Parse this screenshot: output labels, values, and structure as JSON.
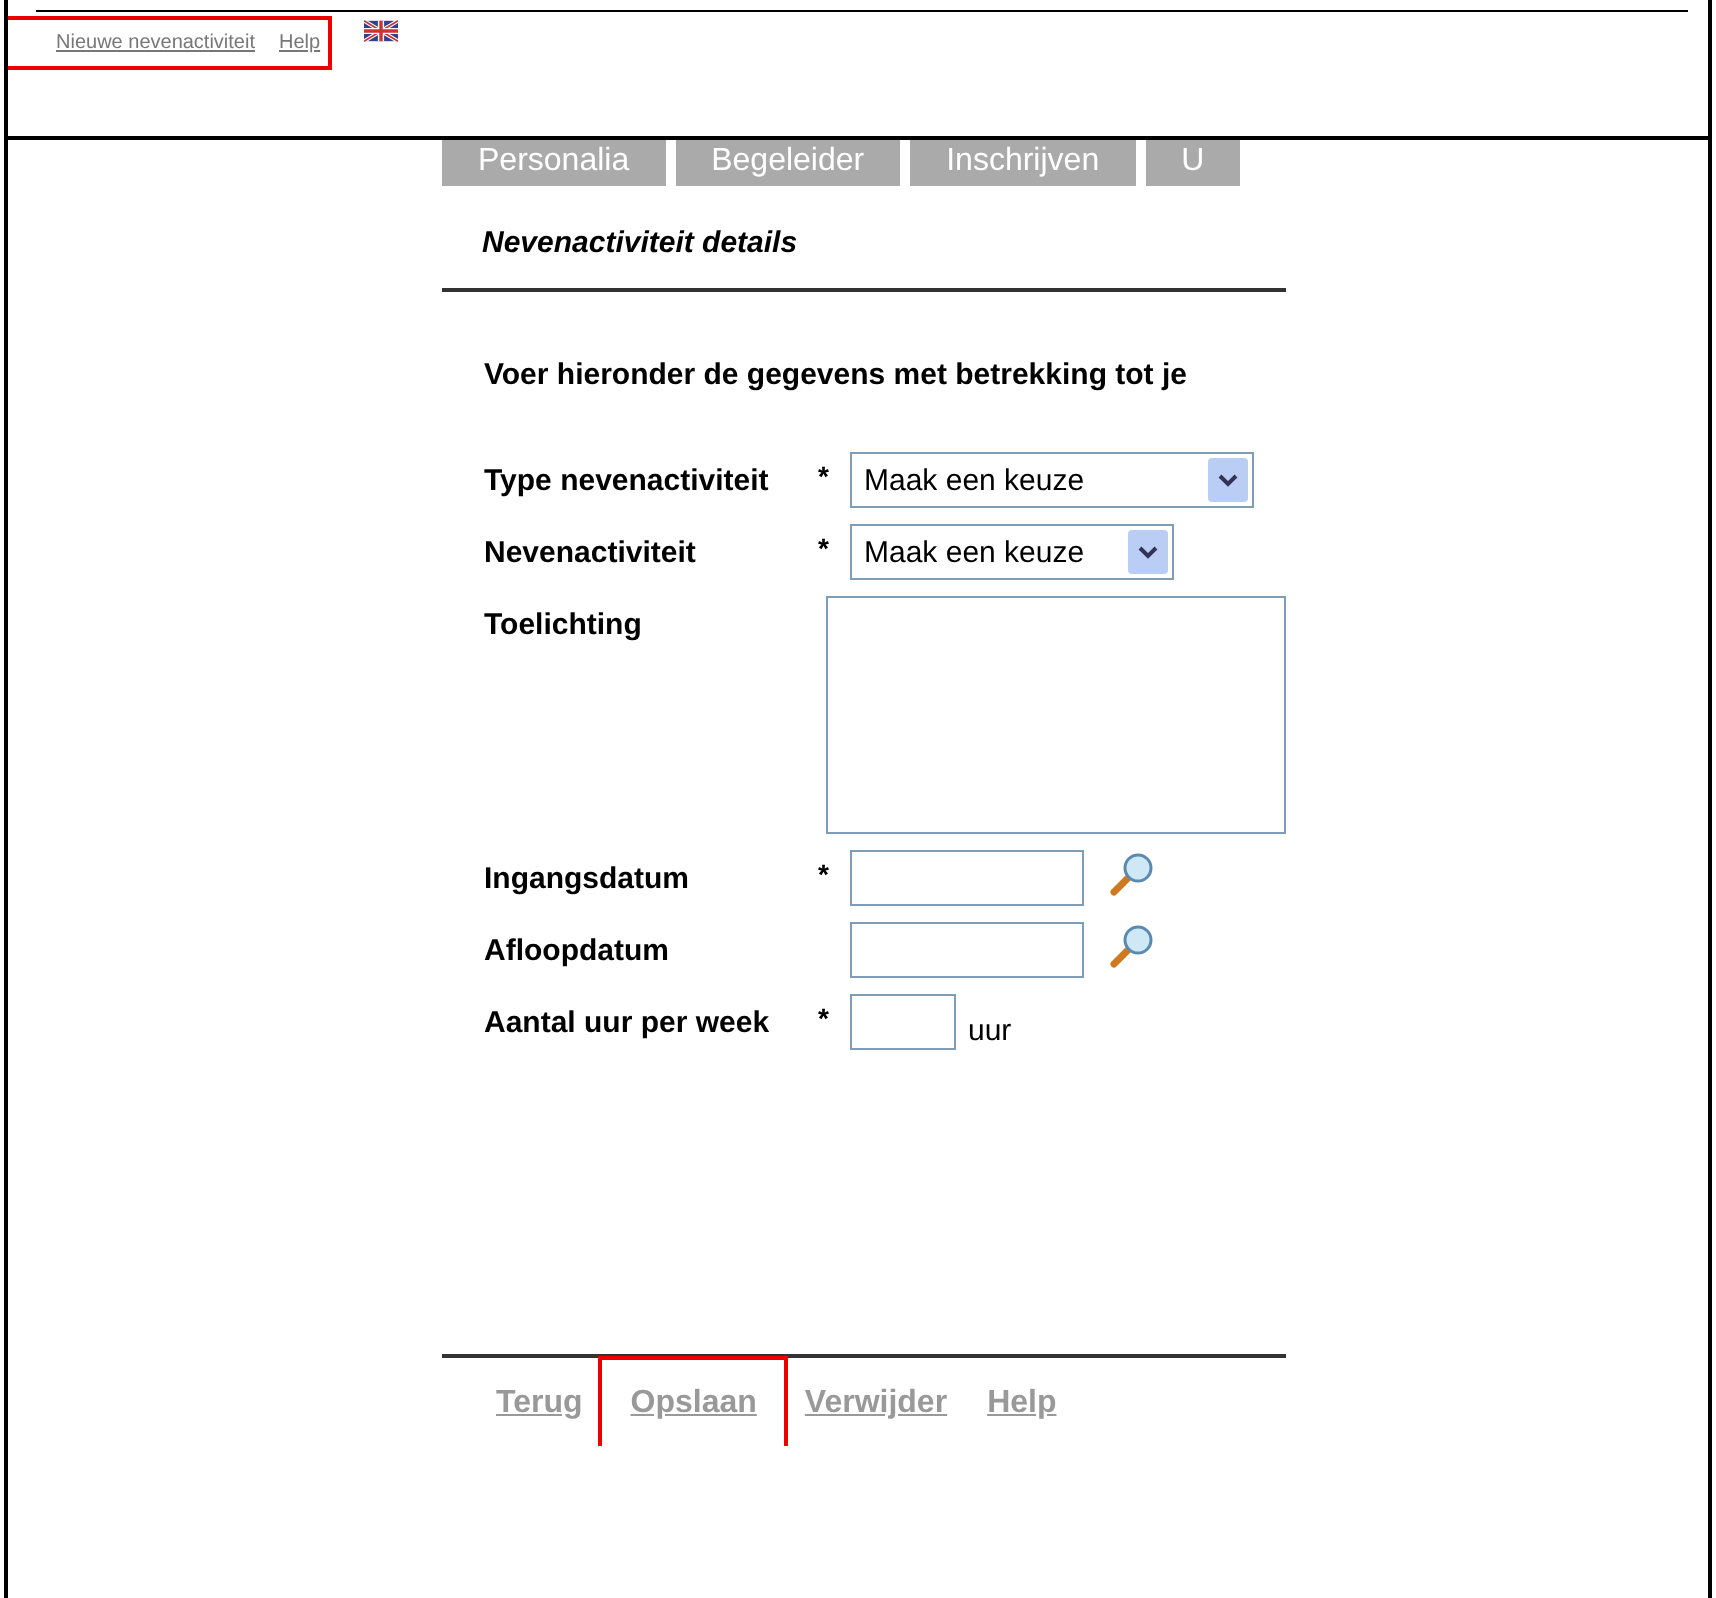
{
  "top_links": {
    "highlighted": true,
    "links": [
      "Nieuwe nevenactiviteit",
      "Help"
    ]
  },
  "tabs": [
    {
      "label": "Personalia",
      "selected": false
    },
    {
      "label": "Begeleider",
      "selected": false
    },
    {
      "label": "Inschrijven",
      "selected": false
    },
    {
      "label": "U",
      "selected": false
    }
  ],
  "section_title": "Nevenactiviteit details",
  "intro": "Voer hieronder de gegevens met betrekking tot je",
  "fields": [
    {
      "kind": "select",
      "label": "Type nevenactiviteit",
      "required": "*",
      "value": "Maak een keuze",
      "wide": true
    },
    {
      "kind": "select",
      "label": "Nevenactiviteit",
      "required": "*",
      "value": "Maak een keuze",
      "wide": false
    },
    {
      "kind": "textarea",
      "label": "Toelichting"
    },
    {
      "kind": "date",
      "label": "Ingangsdatum",
      "required": "*"
    },
    {
      "kind": "date",
      "label": "Afloopdatum"
    },
    {
      "kind": "number",
      "label": "Aantal uur per week",
      "required": "*",
      "unit": "uur"
    }
  ],
  "bottom_links": [
    {
      "label": "Terug",
      "highlighted": false
    },
    {
      "label": "Opslaan",
      "highlighted": true
    },
    {
      "label": "Verwijder",
      "highlighted": false
    },
    {
      "label": "Help",
      "highlighted": false
    }
  ]
}
